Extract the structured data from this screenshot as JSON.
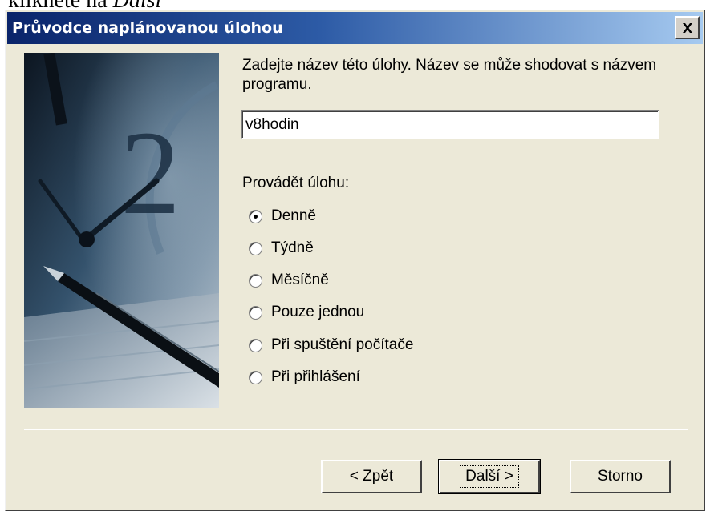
{
  "fragment": {
    "text": "klikněte na ",
    "italic": "Další"
  },
  "window": {
    "title": "Průvodce naplánovanou úlohou",
    "close_icon": "close-icon"
  },
  "main": {
    "prompt": "Zadejte název této úlohy. Název se může shodovat s názvem programu.",
    "task_name_value": "v8hodin",
    "frequency_label": "Provádět úlohu:",
    "options": [
      {
        "label": "Denně",
        "checked": true
      },
      {
        "label": "Týdně",
        "checked": false
      },
      {
        "label": "Měsíčně",
        "checked": false
      },
      {
        "label": "Pouze jednou",
        "checked": false
      },
      {
        "label": "Při spuštění počítače",
        "checked": false
      },
      {
        "label": "Při přihlášení",
        "checked": false
      }
    ]
  },
  "footer": {
    "back_label": "< Zpět",
    "next_label": "Další >",
    "cancel_label": "Storno"
  },
  "colors": {
    "dialog_bg": "#ece9d8",
    "title_start": "#0a246a",
    "title_end": "#a6caf0"
  }
}
